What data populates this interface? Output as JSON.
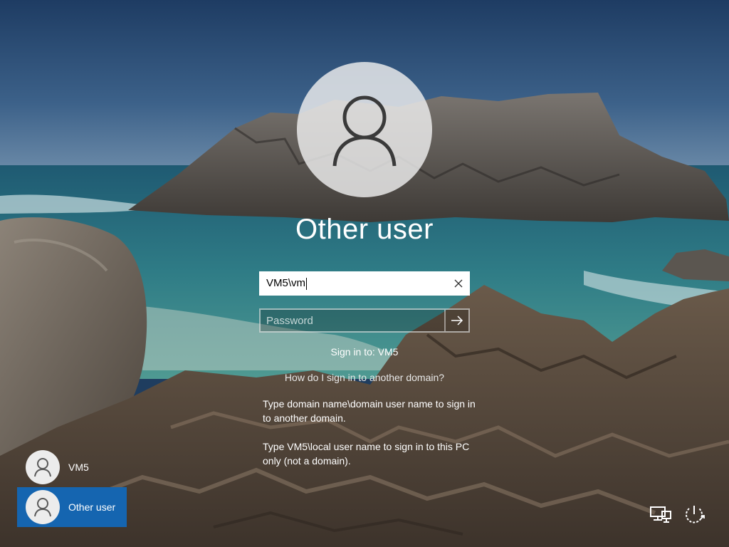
{
  "login": {
    "selected_user": "Other user",
    "username_value": "VM5\\vm",
    "password_placeholder": "Password",
    "signin_to": "Sign in to: VM5",
    "help_link": "How do I sign in to another domain?",
    "hint_domain": "Type domain name\\domain user name to sign in to another domain.",
    "hint_local": "Type VM5\\local user name to sign in to this PC only (not a domain)."
  },
  "users": [
    {
      "label": "VM5",
      "icon": "user-icon",
      "selected": false
    },
    {
      "label": "Other user",
      "icon": "user-icon",
      "selected": true
    }
  ],
  "system_icons": {
    "network": "network-icon",
    "power": "power-icon"
  },
  "colors": {
    "selected_tile": "#1565b0",
    "input_background": "#ffffff",
    "text": "#ffffff"
  }
}
